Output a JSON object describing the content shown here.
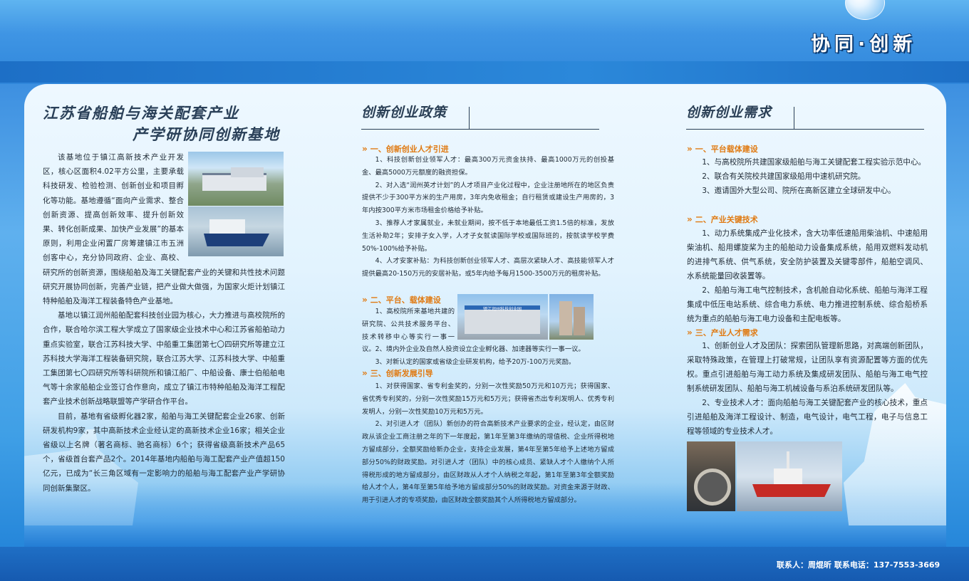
{
  "header": {
    "slogan": "协同·创新"
  },
  "left": {
    "title_line1": "江苏省船舶与海关配套产业",
    "title_line2": "产学研协同创新基地",
    "paragraphs": [
      "该基地位于镇江高新技术产业开发区，核心区面积4.02平方公里，主要承载科技研发、检验检测、创新创业和项目孵化等功能。基地遵循“面向产业需求、整合创新资源、提高创新效率、提升创新效果、转化创新成果、加快产业发展”的基本原则，利用企业闲置厂房筹建镇江市五洲创客中心，充分协同政府、企业、高校、研究所的创新资源，围绕船舶及海工关键配套产业的关键和共性技术问题研究开展协同创新，完善产业链，把产业做大做强，为国家火炬计划镇江特种船舶及海洋工程装备特色产业基地。",
      "基地以镇江润州船舶配套科技创业园为核心，大力推进与高校院所的合作，联合哈尔滨工程大学成立了国家级企业技术中心和江苏省船舶动力重点实验室，联合江苏科技大学、中船重工集团第七〇四研究所等建立江苏科技大学海洋工程装备研究院，联合江苏大学、江苏科技大学、中船重工集团第七〇四研究所等科研院所和镇江船厂、中船设备、康士伯船舶电气等十余家船舶企业签订合作意向，成立了镇江市特种船舶及海洋工程配套产业技术创新战略联盟等产学研合作平台。",
      "目前，基地有省级孵化器2家，船舶与海工关键配套企业26家、创新研发机构9家，其中高新技术企业经认定的高新技术企业16家；相关企业省级以上名牌（著名商标、驰名商标）6个；获得省级高新技术产品65个，省级首台套产品2个。2014年基地内船舶与海工配套产业产值超150亿元，已成为“长三角区域有一定影响力的船舶与海工配套产业产学研协同创新集聚区。"
    ]
  },
  "middle": {
    "title": "创新创业政策",
    "sections": [
      {
        "heading": "一、创新创业人才引进",
        "items": [
          "1、科技创新创业领军人才：最高300万元资金扶持、最高1000万元的创投基金、最高5000万元额度的融资担保。",
          "2、对入选“润州英才计划”的人才项目产业化过程中，企业注册地所在的地区负责提供不少于300平方米的生产用房，3年内免收租金；自行租赁或建设生产用房的，3年内按300平方米市场租金价格给予补贴。",
          "3、推荐人才家属就业，未就业期间，按不低于本地最低工资1.5倍的标准，发放生活补助2年；安排子女入学，人才子女就读国际学校或国际班的，按就读学校学费50%-100%给予补贴。",
          "4、人才安家补贴：为科技创新创业领军人才、高层次紧缺人才、高技能领军人才提供最高20-150万元的安居补贴，或5年内给予每月1500-3500万元的租房补贴。"
        ]
      },
      {
        "heading": "二、平台、载体建设",
        "items": [
          "1、高校院所来基地共建的研究院、公共技术服务平台、技术转移中心等实行一事一议。",
          "2、境内外企业及自然人投资设立企业孵化器、加速器等实行一事一议。",
          "3、对新认定的国家或省级企业研发机构，给予20万-100万元奖励。"
        ]
      },
      {
        "heading": "三、创新发展引导",
        "items": [
          "1、对获得国家、省专利金奖的，分别一次性奖励50万元和10万元；获得国家、省优秀专利奖的，分别一次性奖励15万元和5万元；获得省杰出专利发明人、优秀专利发明人，分别一次性奖励10万元和5万元。",
          "2、对引进人才（团队）新创办的符合高新技术产业要求的企业，经认定，由区财政从该企业工商注册之年的下一年度起，第1年至第3年缴纳的增值税、企业所得税地方留成部分，全额奖励给新办企业，支持企业发展，第4年至第5年给予上述地方留成部分50%的财政奖励。对引进人才（团队）中的核心成员、紧缺人才个人缴纳个人所得税形成的地方留成部分，由区财政从人才个人纳税之年起，第1年至第3年全额奖励给人才个人，第4年至第5年给予地方留成部分50%的财政奖励。对资金来源于财政、用于引进人才的专项奖励，由区财政全额奖励其个人所得税地方留成部分。"
        ]
      }
    ],
    "gate_sign": "镇江润州科技创业园"
  },
  "right": {
    "title": "创新创业需求",
    "sections": [
      {
        "heading": "一、平台载体建设",
        "items": [
          "1、与高校院所共建国家级船舶与海工关键配套工程实验示范中心。",
          "2、联合有关院校共建国家级船用中速机研究院。",
          "3、邀请国外大型公司、院所在高新区建立全球研发中心。"
        ]
      },
      {
        "heading": "二、产业关键技术",
        "items": [
          "1、动力系统集成产业化技术，含大功率低速船用柴油机、中速船用柴油机、船用螺旋桨为主的船舶动力设备集成系统，船用双燃料发动机的进排气系统、供气系统，安全防护装置及关键零部件，船舶空调风、水系统能量回收装置等。",
          "2、船舶与海工电气控制技术，含机舱自动化系统、船舶与海洋工程集成中低压电站系统、综合电力系统、电力推进控制系统、综合船桥系统为重点的船舶与海工电力设备和主配电板等。"
        ]
      },
      {
        "heading": "三、产业人才需求",
        "items": [
          "1、创新创业人才及团队：探索团队管理新思路，对高端创新团队，采取特殊政策，在管理上打破常规，让团队享有资源配置等方面的优先权。重点引进船舶与海工动力系统及集成研发团队、船舶与海工电气控制系统研发团队、船舶与海工机械设备与系泊系统研发团队等。",
          "2、专业技术人才：面向船舶与海工关键配套产业的核心技术，重点引进船舶及海洋工程设计、制造，电气设计，电气工程，电子与信息工程等领域的专业技术人才。"
        ]
      }
    ]
  },
  "footer": {
    "contact": "联系人：周焜昕   联系电话：137-7553-3669"
  },
  "colors": {
    "accent": "#e07a12",
    "title": "#2a3f55",
    "band": "#2b82d6"
  }
}
